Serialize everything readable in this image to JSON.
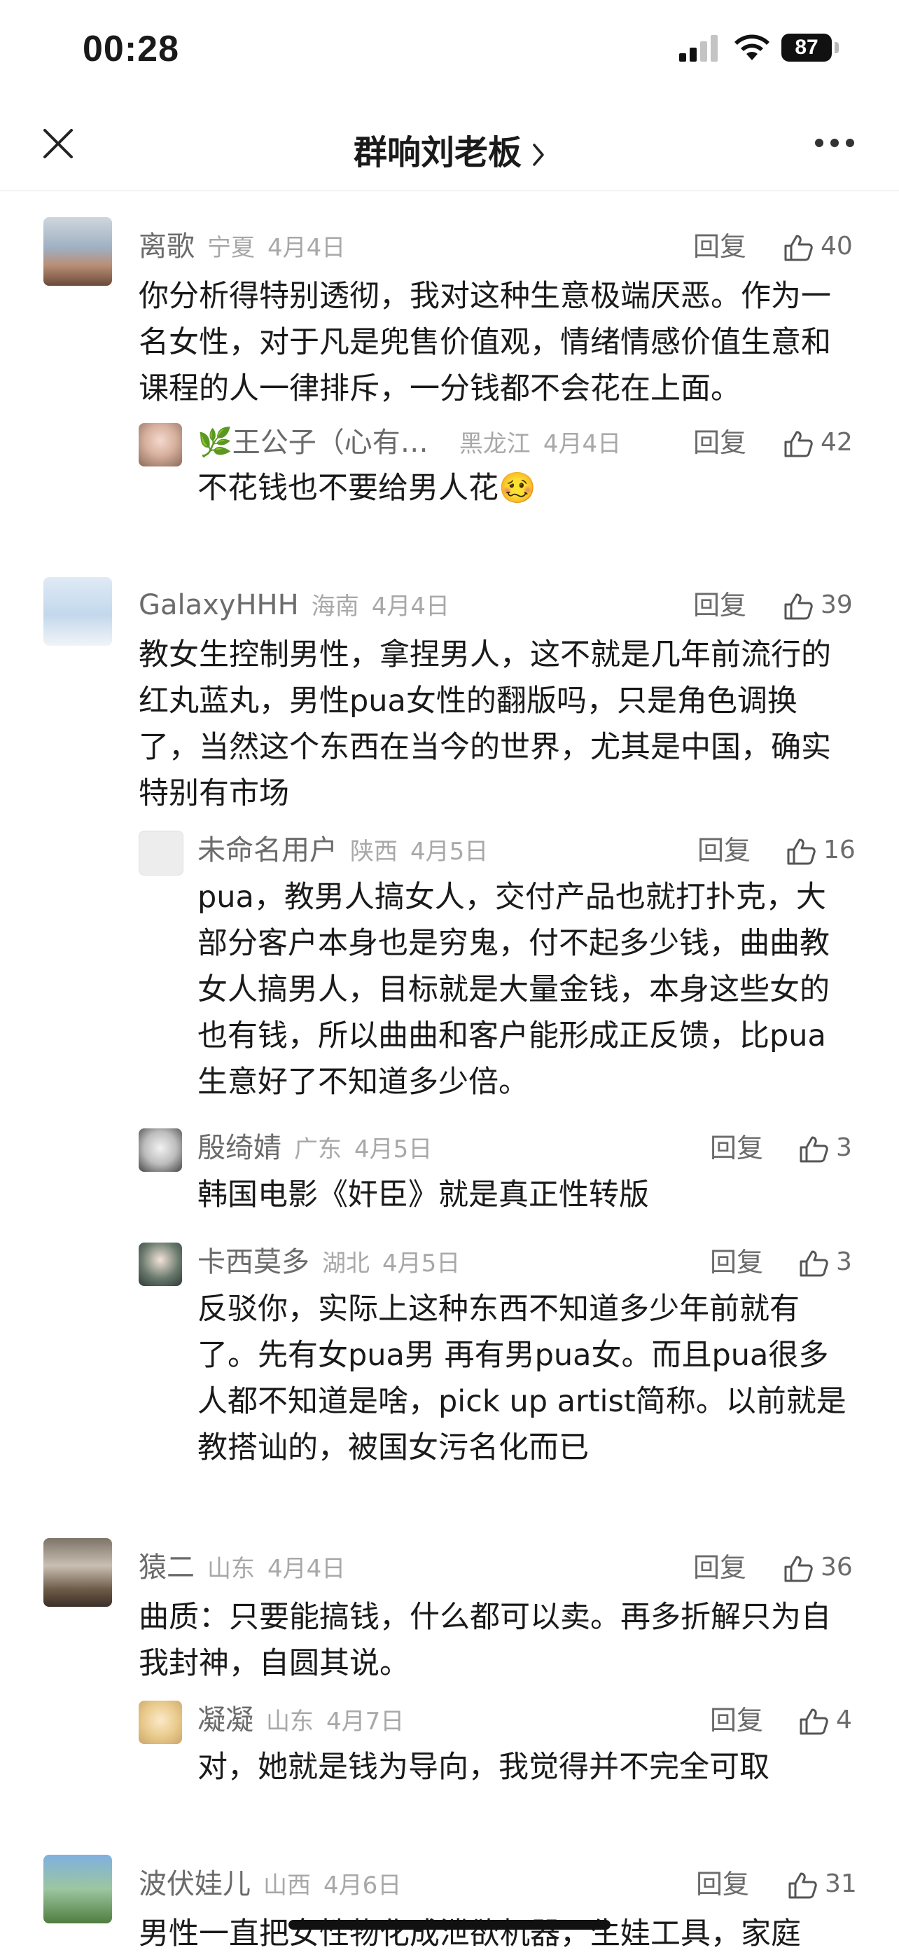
{
  "status_bar": {
    "time": "00:28",
    "battery": "87"
  },
  "nav": {
    "title": "群响刘老板"
  },
  "comments": [
    {
      "name": "离歌",
      "location": "宁夏",
      "date": "4月4日",
      "reply": "回复",
      "likes": "40",
      "text": "你分析得特别透彻，我对这种生意极端厌恶。作为一名女性，对于凡是兜售价值观，情绪情感价值生意和课程的人一律排斥，一分钱都不会花在上面。"
    },
    {
      "name": "🌿王公子（心有…",
      "location": "黑龙江",
      "date": "4月4日",
      "reply": "回复",
      "likes": "42",
      "text": "不花钱也不要给男人花🥴"
    },
    {
      "name": "GalaxyHHH",
      "location": "海南",
      "date": "4月4日",
      "reply": "回复",
      "likes": "39",
      "text": "教女生控制男性，拿捏男人，这不就是几年前流行的红丸蓝丸，男性pua女性的翻版吗，只是角色调换了，当然这个东西在当今的世界，尤其是中国，确实特别有市场"
    },
    {
      "name": "未命名用户",
      "location": "陕西",
      "date": "4月5日",
      "reply": "回复",
      "likes": "16",
      "text": "pua，教男人搞女人，交付产品也就打扑克，大部分客户本身也是穷鬼，付不起多少钱，曲曲教女人搞男人，目标就是大量金钱，本身这些女的也有钱，所以曲曲和客户能形成正反馈，比pua生意好了不知道多少倍。"
    },
    {
      "name": "殷绮婧",
      "location": "广东",
      "date": "4月5日",
      "reply": "回复",
      "likes": "3",
      "text": "韩国电影《奸臣》就是真正性转版"
    },
    {
      "name": "卡西莫多",
      "location": "湖北",
      "date": "4月5日",
      "reply": "回复",
      "likes": "3",
      "text": "反驳你，实际上这种东西不知道多少年前就有了。先有女pua男 再有男pua女。而且pua很多人都不知道是啥，pick up artist简称。以前就是教搭讪的，被国女污名化而已"
    },
    {
      "name": "猿二",
      "location": "山东",
      "date": "4月4日",
      "reply": "回复",
      "likes": "36",
      "text": "曲质：只要能搞钱，什么都可以卖。再多折解只为自我封神，自圆其说。"
    },
    {
      "name": "凝凝",
      "location": "山东",
      "date": "4月7日",
      "reply": "回复",
      "likes": "4",
      "text": "对，她就是钱为导向，我觉得并不完全可取"
    },
    {
      "name": "波伏娃儿",
      "location": "山西",
      "date": "4月6日",
      "reply": "回复",
      "likes": "31",
      "text": "男性一直把女性物化成泄欲机器，生娃工具，家庭"
    }
  ]
}
